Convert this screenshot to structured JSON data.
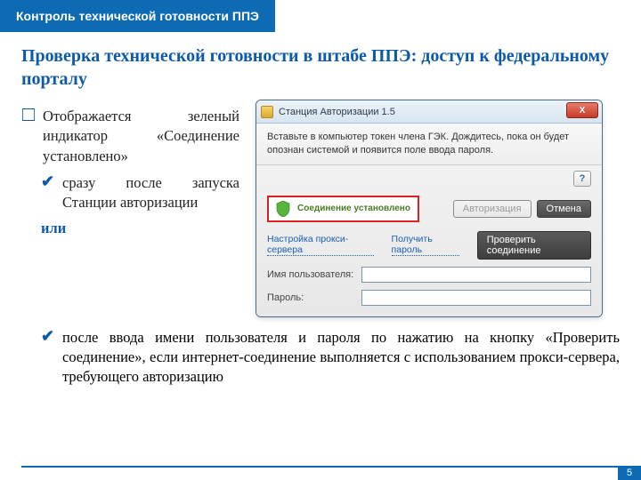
{
  "banner": "Контроль технической готовности ППЭ",
  "title": "Проверка технической готовности в штабе ППЭ: доступ к федеральному порталу",
  "bullet_main": "Отображается зеленый индикатор «Соединение установлено»",
  "sub1": "сразу после запуска Станции авторизации",
  "or": "или",
  "sub2": "после ввода имени пользователя и пароля по нажатию на кнопку «Проверить соединение», если интернет-соединение выполняется с использованием прокси-сервера, требующего авторизацию",
  "dialog": {
    "title": "Станция Авторизации 1.5",
    "close": "X",
    "prompt": "Вставьте в компьютер токен члена ГЭК. Дождитесь, пока он будет опознан системой и появится поле ввода пароля.",
    "help": "?",
    "status": "Соединение установлено",
    "btn_auth": "Авторизация",
    "btn_cancel": "Отмена",
    "link_proxy": "Настройка прокси-сервера",
    "link_getpass": "Получить пароль",
    "btn_check": "Проверить соединение",
    "label_user": "Имя пользователя:",
    "label_pass": "Пароль:",
    "user_value": "",
    "pass_value": ""
  },
  "page_num": "5"
}
